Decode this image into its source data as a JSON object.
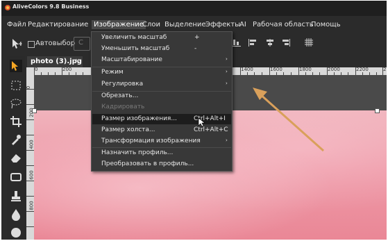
{
  "title_bar": {
    "title": "AliveColors 9.8 Business"
  },
  "menubar": {
    "items": [
      "Файл",
      "Редактирование",
      "Изображение",
      "Слои",
      "Выделение",
      "Эффекты",
      "AI",
      "Рабочая область",
      "Помощь"
    ],
    "active": "Изображение"
  },
  "options_bar": {
    "auto_select_label": "Автовыбор",
    "auto_select_checked": false,
    "select_value": "С"
  },
  "document_tab": {
    "name": "photo (3).jpg",
    "close": "×"
  },
  "ruler": {
    "h_labels": [
      "0",
      "200",
      "1400",
      "1600",
      "1800",
      "2000",
      "2200",
      "2"
    ],
    "v_labels": [
      "0",
      "200",
      "400",
      "600",
      "800"
    ]
  },
  "image_menu": {
    "items": [
      {
        "label": "Увеличить масштаб",
        "shortcut": "+"
      },
      {
        "label": "Уменьшить масштаб",
        "shortcut": "-"
      },
      {
        "label": "Масштабирование",
        "submenu": "›"
      },
      {
        "label": "Режим",
        "submenu": "›"
      },
      {
        "label": "Регулировка",
        "submenu": "›"
      },
      {
        "label": "Обрезать..."
      },
      {
        "label": "Кадрировать",
        "disabled": true
      },
      {
        "label": "Размер изображения...",
        "shortcut": "Ctrl+Alt+I",
        "highlighted": true
      },
      {
        "label": "Размер холста...",
        "shortcut": "Ctrl+Alt+C"
      },
      {
        "label": "Трансформация изображения",
        "submenu": "›"
      },
      {
        "label": "Назначить профиль..."
      },
      {
        "label": "Преобразовать в профиль..."
      }
    ]
  },
  "annotation": {
    "color": "#d9a05b",
    "type": "arrow"
  },
  "colors": {
    "canvas_image": "#ee9aa8",
    "menu_bg": "#383838",
    "highlight": "#1d1d1d"
  }
}
